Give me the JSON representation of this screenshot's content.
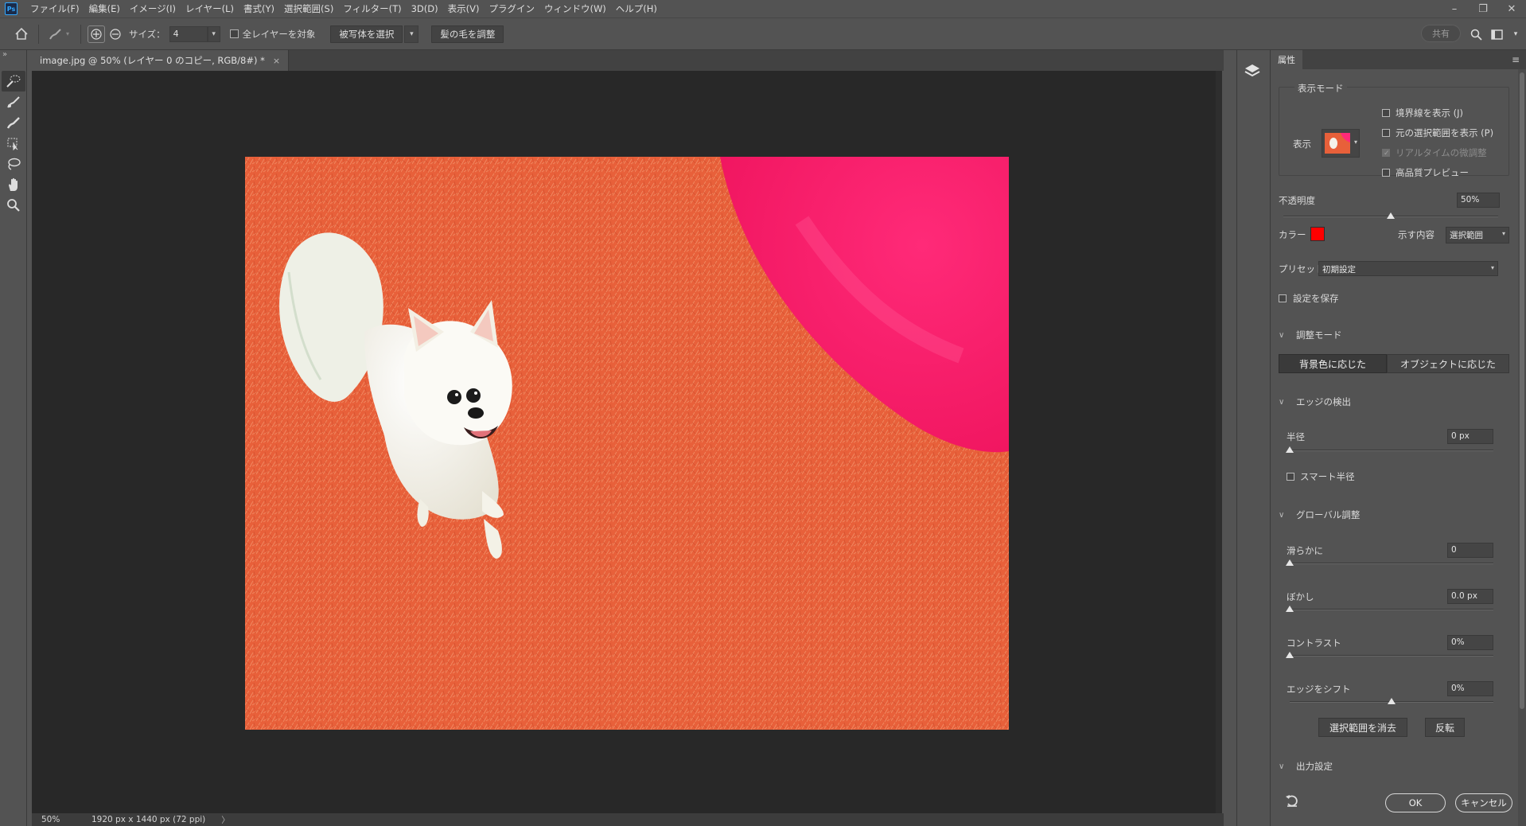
{
  "menu": {
    "items": [
      "ファイル(F)",
      "編集(E)",
      "イメージ(I)",
      "レイヤー(L)",
      "書式(Y)",
      "選択範囲(S)",
      "フィルター(T)",
      "3D(D)",
      "表示(V)",
      "プラグイン",
      "ウィンドウ(W)",
      "ヘルプ(H)"
    ],
    "logo": "Ps"
  },
  "options": {
    "size_label": "サイズ：",
    "size_value": "4",
    "all_layers_label": "全レイヤーを対象",
    "select_subject_label": "被写体を選択",
    "refine_hair_label": "髪の毛を調整",
    "share_label": "共有"
  },
  "document": {
    "tab_title": "image.jpg @ 50% (レイヤー 0 のコピー, RGB/8#) *",
    "close": "×"
  },
  "status": {
    "zoom": "50%",
    "info": "1920 px x 1440 px (72 ppi)",
    "arrow": "〉"
  },
  "properties": {
    "tab_label": "属性",
    "view_mode": {
      "title": "表示モード",
      "view_label": "表示",
      "show_edge": "境界線を表示 (J)",
      "show_original": "元の選択範囲を表示 (P)",
      "realtime": "リアルタイムの微調整",
      "high_quality": "高品質プレビュー"
    },
    "opacity_label": "不透明度",
    "opacity_value": "50%",
    "opacity_level": 0.5,
    "color_label": "カラー",
    "color_value": "#ff0000",
    "indicates_label": "示す内容",
    "indicates_value": "選択範囲",
    "preset_label": "プリセット",
    "preset_value": "初期設定",
    "remember_label": "設定を保存",
    "refine_mode": {
      "title": "調整モード",
      "color_aware": "背景色に応じた",
      "object_aware": "オブジェクトに応じた"
    },
    "edge_detection": {
      "title": "エッジの検出",
      "radius_label": "半径",
      "radius_value": "0 px",
      "smart_radius": "スマート半径"
    },
    "global": {
      "title": "グローバル調整",
      "smooth_label": "滑らかに",
      "smooth_value": "0",
      "feather_label": "ぼかし",
      "feather_value": "0.0 px",
      "contrast_label": "コントラスト",
      "contrast_value": "0%",
      "shift_label": "エッジをシフト",
      "shift_value": "0%",
      "clear_btn": "選択範囲を消去",
      "invert_btn": "反転"
    },
    "output": {
      "title": "出力設定"
    },
    "ok_label": "OK",
    "cancel_label": "キャンセル"
  },
  "colors": {
    "overlay": "#e8603a",
    "ball": "#ff1f6e",
    "dog": "#f1efe6"
  }
}
